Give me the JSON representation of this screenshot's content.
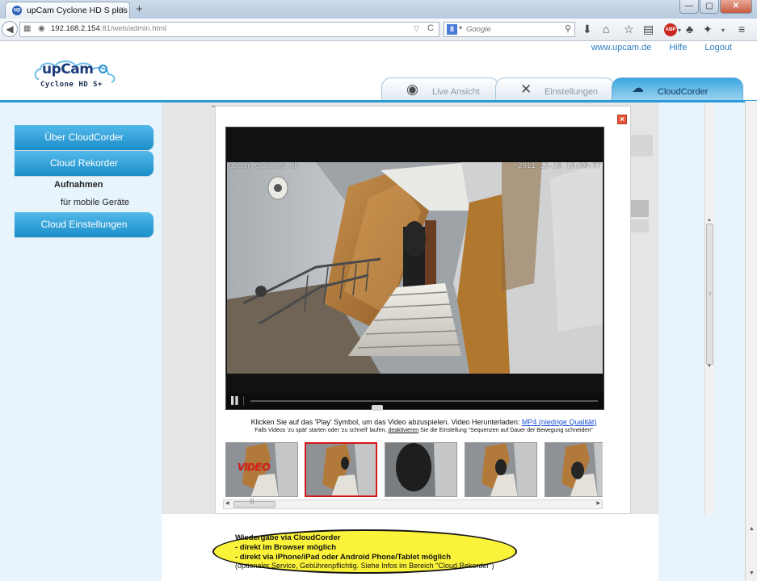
{
  "browser": {
    "tab_title": "upCam Cyclone HD S plus",
    "tab_close": "×",
    "new_tab": "+",
    "window_buttons": [
      "—",
      "▢",
      "✕"
    ],
    "url_host": "192.168.2.154",
    "url_rest": ":81/web/admin.html",
    "search_placeholder": "Google",
    "icons": [
      "back-arrow-icon",
      "page-icon",
      "globe-icon",
      "reload-icon",
      "magnifier-icon",
      "download-icon",
      "home-icon",
      "star-icon",
      "clipboard-icon",
      "adblock-icon",
      "plugin-icon",
      "menu-icon"
    ]
  },
  "header": {
    "logo_main": "upCam",
    "logo_sub": "Cyclone HD S+",
    "links": [
      "www.upcam.de",
      "Hilfe",
      "Logout"
    ],
    "tabs": [
      {
        "label": "Live Ansicht",
        "icon": "eye-icon"
      },
      {
        "label": "Einstellungen",
        "icon": "tools-icon"
      },
      {
        "label": "CloudCorder",
        "icon": "cloud-car-icon"
      }
    ],
    "active_tab": "CloudCorder",
    "accent_color": "#2a9ad6"
  },
  "sidebar": {
    "buttons": [
      "Über CloudCorder",
      "Cloud Rekorder",
      "Cloud Einstellungen"
    ],
    "sub_heading": "Aufnahmen",
    "sub_item": "für mobile Geräte"
  },
  "player": {
    "osd_left": "upCam Cyclone HD",
    "osd_time": "2011-12-18 13:50:37",
    "pause_icon": "pause-icon",
    "progress_fraction": 0.36
  },
  "modal": {
    "close_label": "×",
    "hint_line1_prefix": "Klicken Sie auf das 'Play' Symbol, um das Video abzuspielen.     Video Herunterladen:",
    "hint_line1_link": "MP4 (niedrige Qualität)",
    "hint_line2_prefix": "Falls Videos 'zu spät' starten oder 'zu schnell' laufen,",
    "hint_line2_link": "deaktivieren",
    "hint_line2_suffix": "Sie die Einstellung \"Sequenzen auf Dauer der Bewegung schneiden\"",
    "thumb_badge": "VIDEO",
    "selected_thumb_index": 1
  },
  "callout": {
    "lines": [
      "Wiedergabe via CloudCorder",
      "- direkt im Browser möglich",
      "- direkt via iPhone/iPad oder Android Phone/Tablet möglich",
      "(optionaler Service, Gebührenpflichtig. Siehe Infos im Bereich \"Cloud Rekorder\")"
    ]
  }
}
